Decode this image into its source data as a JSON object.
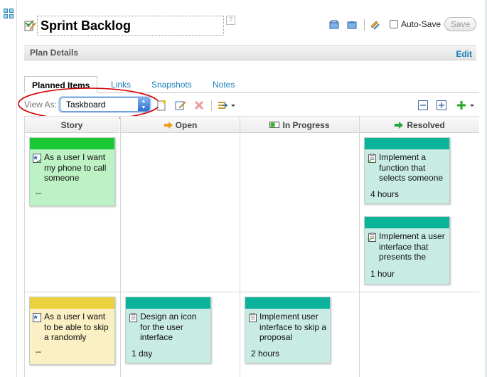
{
  "header": {
    "title": "Sprint Backlog",
    "help": "?",
    "autosave_label": "Auto-Save",
    "save_label": "Save"
  },
  "details": {
    "title": "Plan Details",
    "edit_label": "Edit"
  },
  "tabs": [
    {
      "label": "Planned Items",
      "active": true
    },
    {
      "label": "Links",
      "active": false
    },
    {
      "label": "Snapshots",
      "active": false
    },
    {
      "label": "Notes",
      "active": false
    }
  ],
  "toolbar": {
    "view_as_label": "View As:",
    "view_as_value": "Taskboard"
  },
  "board": {
    "columns": [
      {
        "label": "Story"
      },
      {
        "label": "Open"
      },
      {
        "label": "In Progress"
      },
      {
        "label": "Resolved"
      }
    ],
    "cards": {
      "story1": {
        "text": "As a user I want my phone to call someone",
        "foot": "--"
      },
      "resolved1": {
        "text": "Implement a function that selects someone",
        "foot": "4 hours"
      },
      "resolved2": {
        "text": "Implement a user interface that presents the",
        "foot": "1 hour"
      },
      "story2": {
        "text": "As a user I want to be able to skip a randomly",
        "foot": "--"
      },
      "open1": {
        "text": "Design an icon for the user interface",
        "foot": "1 day"
      },
      "inprogress1": {
        "text": "Implement user interface to skip a proposal",
        "foot": "2 hours"
      }
    }
  },
  "colors": {
    "story_bar": "#19c832",
    "task_bar": "#0bb39b",
    "story2_bar": "#ebd23c",
    "link": "#1a7fb5",
    "annotation": "#d40000"
  }
}
